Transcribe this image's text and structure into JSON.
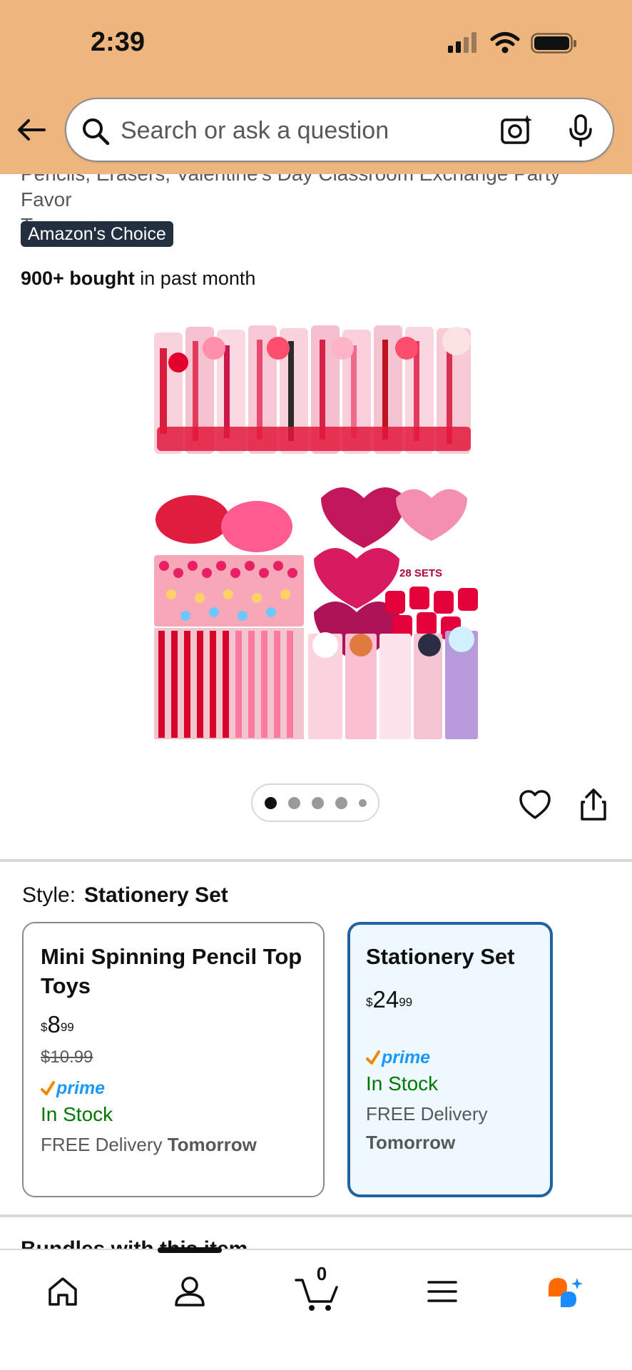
{
  "status_bar": {
    "time": "2:39"
  },
  "header": {
    "search_placeholder": "Search or ask a question"
  },
  "product": {
    "title_tail_line1": "Pencils, Erasers, Valentine's Day Classroom Exchange Party Favor",
    "title_tail_line2": "Toy",
    "badge": "Amazon's Choice",
    "bought_bold": "900+ bought",
    "bought_rest": " in past month",
    "image_label": "28 SETS",
    "image_count": 5,
    "image_current": 1
  },
  "style": {
    "label": "Style:",
    "selected": "Stationery Set",
    "options": [
      {
        "name": "Mini Spinning Pencil Top Toys",
        "currency": "$",
        "price_whole": "8",
        "price_frac": "99",
        "list_price": "$10.99",
        "prime": "prime",
        "stock": "In Stock",
        "delivery": "FREE Delivery",
        "delivery_day": "Tomorrow"
      },
      {
        "name": "Stationery Set",
        "currency": "$",
        "price_whole": "24",
        "price_frac": "99",
        "prime": "prime",
        "stock": "In Stock",
        "delivery": "FREE Delivery",
        "delivery_day": "Tomorrow"
      }
    ]
  },
  "next_section": {
    "heading": "Bundles with this item"
  },
  "bottom_nav": {
    "cart_count": "0"
  },
  "colors": {
    "header_bg": "#eeb57f",
    "selected_border": "#2162a1",
    "selected_bg": "#edf8ff",
    "stock_green": "#007600",
    "prime_blue": "#1a98ff",
    "badge_bg": "#232f3e"
  }
}
